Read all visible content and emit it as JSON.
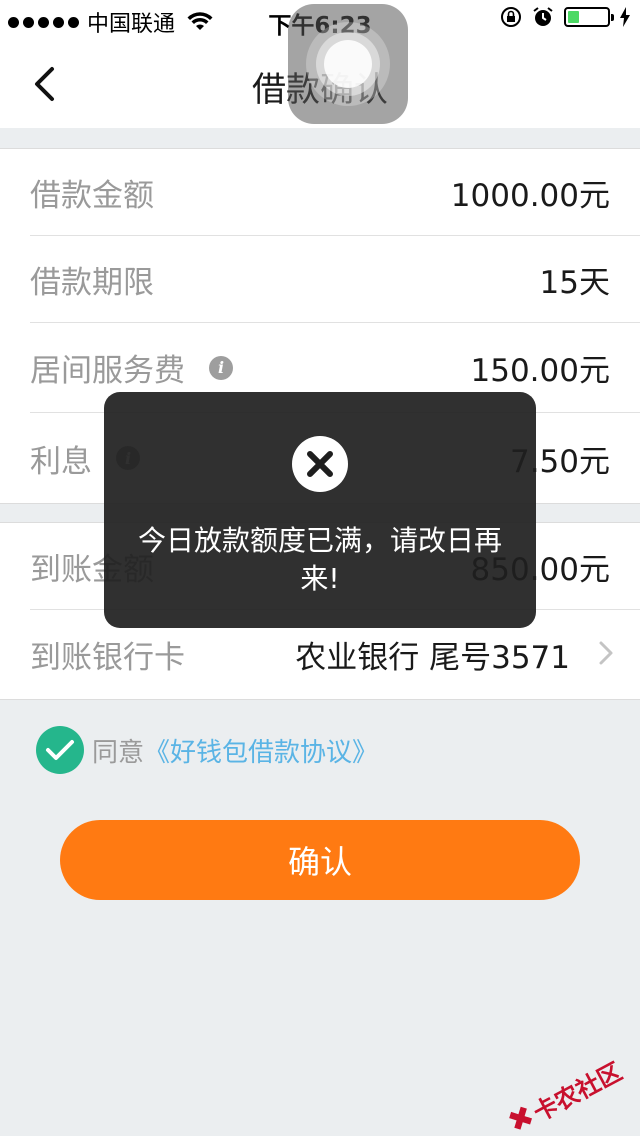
{
  "status_bar": {
    "carrier": "中国联通",
    "time": "下午6:23",
    "battery_level": 0.3,
    "battery_color": "#4cd964"
  },
  "nav": {
    "title": "借款确认",
    "back_icon": "chevron-left-icon"
  },
  "loan_details": [
    {
      "label": "借款金额",
      "value": "1000.00元",
      "has_info": false
    },
    {
      "label": "借款期限",
      "value": "15天",
      "has_info": false
    },
    {
      "label": "居间服务费",
      "value": "150.00元",
      "has_info": true
    },
    {
      "label": "利息",
      "value": "7.50元",
      "has_info": true
    }
  ],
  "payout_details": [
    {
      "label": "到账金额",
      "value": "850.00元"
    },
    {
      "label": "到账银行卡",
      "value": "农业银行 尾号3571"
    }
  ],
  "agreement": {
    "prefix": "同意",
    "link": "《好钱包借款协议》",
    "checked": true,
    "check_color": "#25b68c",
    "link_color": "#5ab4e5"
  },
  "confirm_button": {
    "label": "确认",
    "color": "#ff7a12"
  },
  "toast": {
    "icon": "close-circle-icon",
    "message": "今日放款额度已满，请改日再来!"
  },
  "watermark": {
    "text": "卡农社区",
    "color": "#c8102e"
  }
}
